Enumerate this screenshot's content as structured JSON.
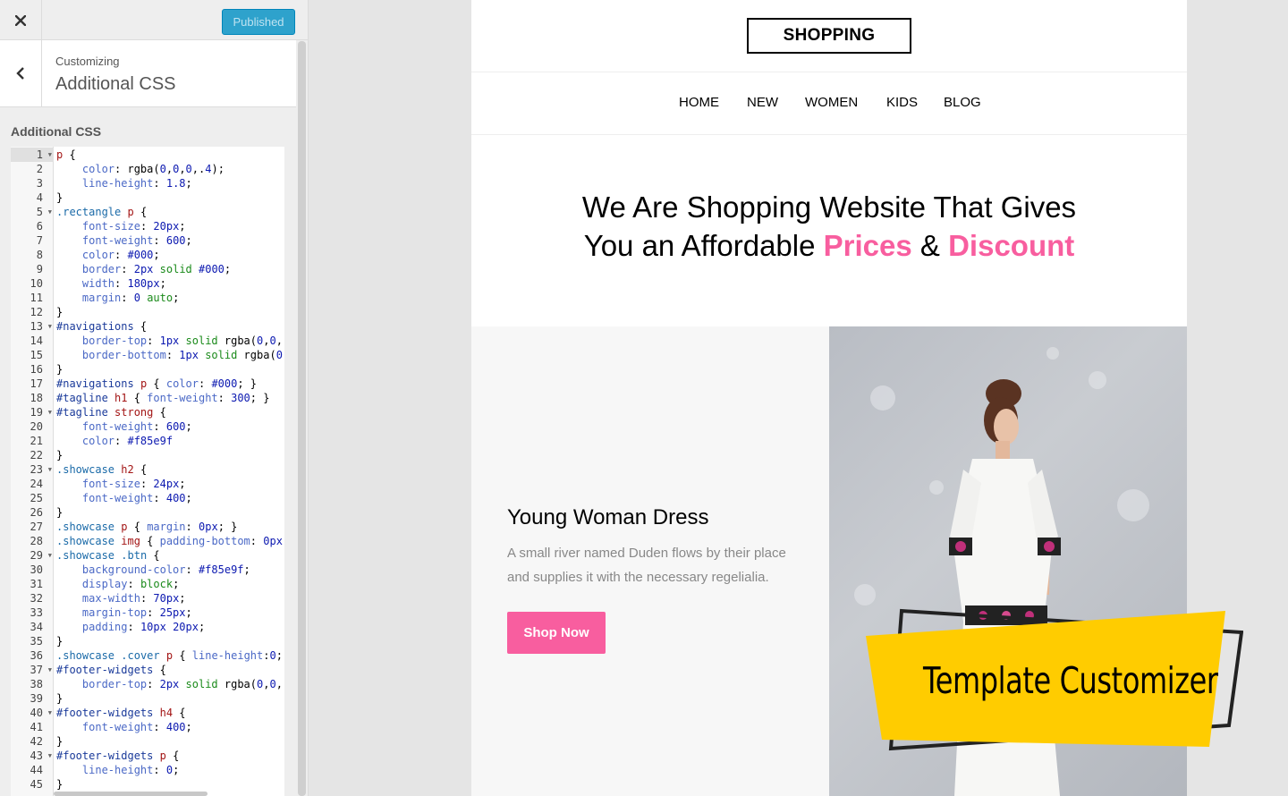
{
  "topbar": {
    "close_icon": "close-icon",
    "publish_label": "Published",
    "publish_color": "#2ea2cc"
  },
  "section": {
    "breadcrumb": "Customizing",
    "title": "Additional CSS",
    "back_icon": "chevron-left-icon"
  },
  "editor": {
    "label": "Additional CSS",
    "active_line": 1,
    "lines": [
      {
        "n": 1,
        "fold": true,
        "text": "p {"
      },
      {
        "n": 2,
        "text": "    color: rgba(0,0,0,.4);"
      },
      {
        "n": 3,
        "text": "    line-height: 1.8;"
      },
      {
        "n": 4,
        "text": "}"
      },
      {
        "n": 5,
        "fold": true,
        "text": ".rectangle p {"
      },
      {
        "n": 6,
        "text": "    font-size: 20px;"
      },
      {
        "n": 7,
        "text": "    font-weight: 600;"
      },
      {
        "n": 8,
        "text": "    color: #000;"
      },
      {
        "n": 9,
        "text": "    border: 2px solid #000;"
      },
      {
        "n": 10,
        "text": "    width: 180px;"
      },
      {
        "n": 11,
        "text": "    margin: 0 auto;"
      },
      {
        "n": 12,
        "text": "}"
      },
      {
        "n": 13,
        "fold": true,
        "text": "#navigations {"
      },
      {
        "n": 14,
        "text": "    border-top: 1px solid rgba(0,0,("
      },
      {
        "n": 15,
        "text": "    border-bottom: 1px solid rgba(0,"
      },
      {
        "n": 16,
        "text": "}"
      },
      {
        "n": 17,
        "text": "#navigations p { color: #000; }"
      },
      {
        "n": 18,
        "text": "#tagline h1 { font-weight: 300; }"
      },
      {
        "n": 19,
        "fold": true,
        "text": "#tagline strong {"
      },
      {
        "n": 20,
        "text": "    font-weight: 600;"
      },
      {
        "n": 21,
        "text": "    color: #f85e9f"
      },
      {
        "n": 22,
        "text": "}"
      },
      {
        "n": 23,
        "fold": true,
        "text": ".showcase h2 {"
      },
      {
        "n": 24,
        "text": "    font-size: 24px;"
      },
      {
        "n": 25,
        "text": "    font-weight: 400;"
      },
      {
        "n": 26,
        "text": "}"
      },
      {
        "n": 27,
        "text": ".showcase p { margin: 0px; }"
      },
      {
        "n": 28,
        "text": ".showcase img { padding-bottom: 0px"
      },
      {
        "n": 29,
        "fold": true,
        "text": ".showcase .btn {"
      },
      {
        "n": 30,
        "text": "    background-color: #f85e9f;"
      },
      {
        "n": 31,
        "text": "    display: block;"
      },
      {
        "n": 32,
        "text": "    max-width: 70px;"
      },
      {
        "n": 33,
        "text": "    margin-top: 25px;"
      },
      {
        "n": 34,
        "text": "    padding: 10px 20px;"
      },
      {
        "n": 35,
        "text": "}"
      },
      {
        "n": 36,
        "text": ".showcase .cover p { line-height:0;"
      },
      {
        "n": 37,
        "fold": true,
        "text": "#footer-widgets {"
      },
      {
        "n": 38,
        "text": "    border-top: 2px solid rgba(0,0,("
      },
      {
        "n": 39,
        "text": "}"
      },
      {
        "n": 40,
        "fold": true,
        "text": "#footer-widgets h4 {"
      },
      {
        "n": 41,
        "text": "    font-weight: 400;"
      },
      {
        "n": 42,
        "text": "}"
      },
      {
        "n": 43,
        "fold": true,
        "text": "#footer-widgets p {"
      },
      {
        "n": 44,
        "text": "    line-height: 0;"
      },
      {
        "n": 45,
        "text": "}"
      }
    ]
  },
  "preview": {
    "logo": "SHOPPING",
    "nav": [
      "HOME",
      "NEW",
      "WOMEN",
      "KIDS",
      "BLOG"
    ],
    "tagline": {
      "line1": "We Are Shopping Website That Gives",
      "line2_pre": "You an Affordable ",
      "highlight1": "Prices",
      "amp": " & ",
      "highlight2": "Discount"
    },
    "accent_color": "#f85e9f",
    "showcase": {
      "title": "Young Woman Dress",
      "description": "A small river named Duden flows by their place and supplies it with the necessary regelialia.",
      "button": "Shop Now"
    }
  },
  "badge": {
    "text": "Template Customizer",
    "color": "#ffcc00"
  }
}
